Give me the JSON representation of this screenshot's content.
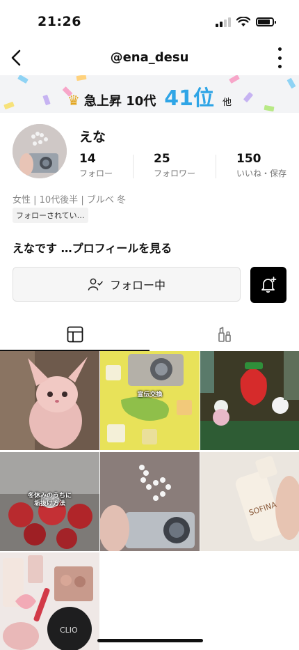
{
  "status": {
    "time": "21:26"
  },
  "nav": {
    "username": "@ena_desu"
  },
  "ranking": {
    "label": "急上昇 10代",
    "rank": "41位",
    "suffix": "他"
  },
  "profile": {
    "name": "えな",
    "stats": [
      {
        "value": "14",
        "label": "フォロー"
      },
      {
        "value": "25",
        "label": "フォロワー"
      },
      {
        "value": "150",
        "label": "いいね・保存"
      }
    ],
    "bio": "女性 | 10代後半 | ブルベ 冬",
    "follow_back": "フォローされてい…",
    "intro": "えなです …プロフィールを見る"
  },
  "actions": {
    "follow_label": "フォロー中"
  },
  "tabs": [
    {
      "icon": "grid-icon"
    },
    {
      "icon": "cosmetics-icon"
    }
  ],
  "posts": [
    {
      "caption": ""
    },
    {
      "caption": "宣伝交換"
    },
    {
      "caption": ""
    },
    {
      "caption": "冬休みのうちに\n垢抜け方法"
    },
    {
      "caption": ""
    },
    {
      "caption": "SOFINA"
    },
    {
      "caption": "CLIO"
    }
  ],
  "colors": {
    "rank_accent": "#2fa5e6",
    "bell_bg": "#000000"
  }
}
